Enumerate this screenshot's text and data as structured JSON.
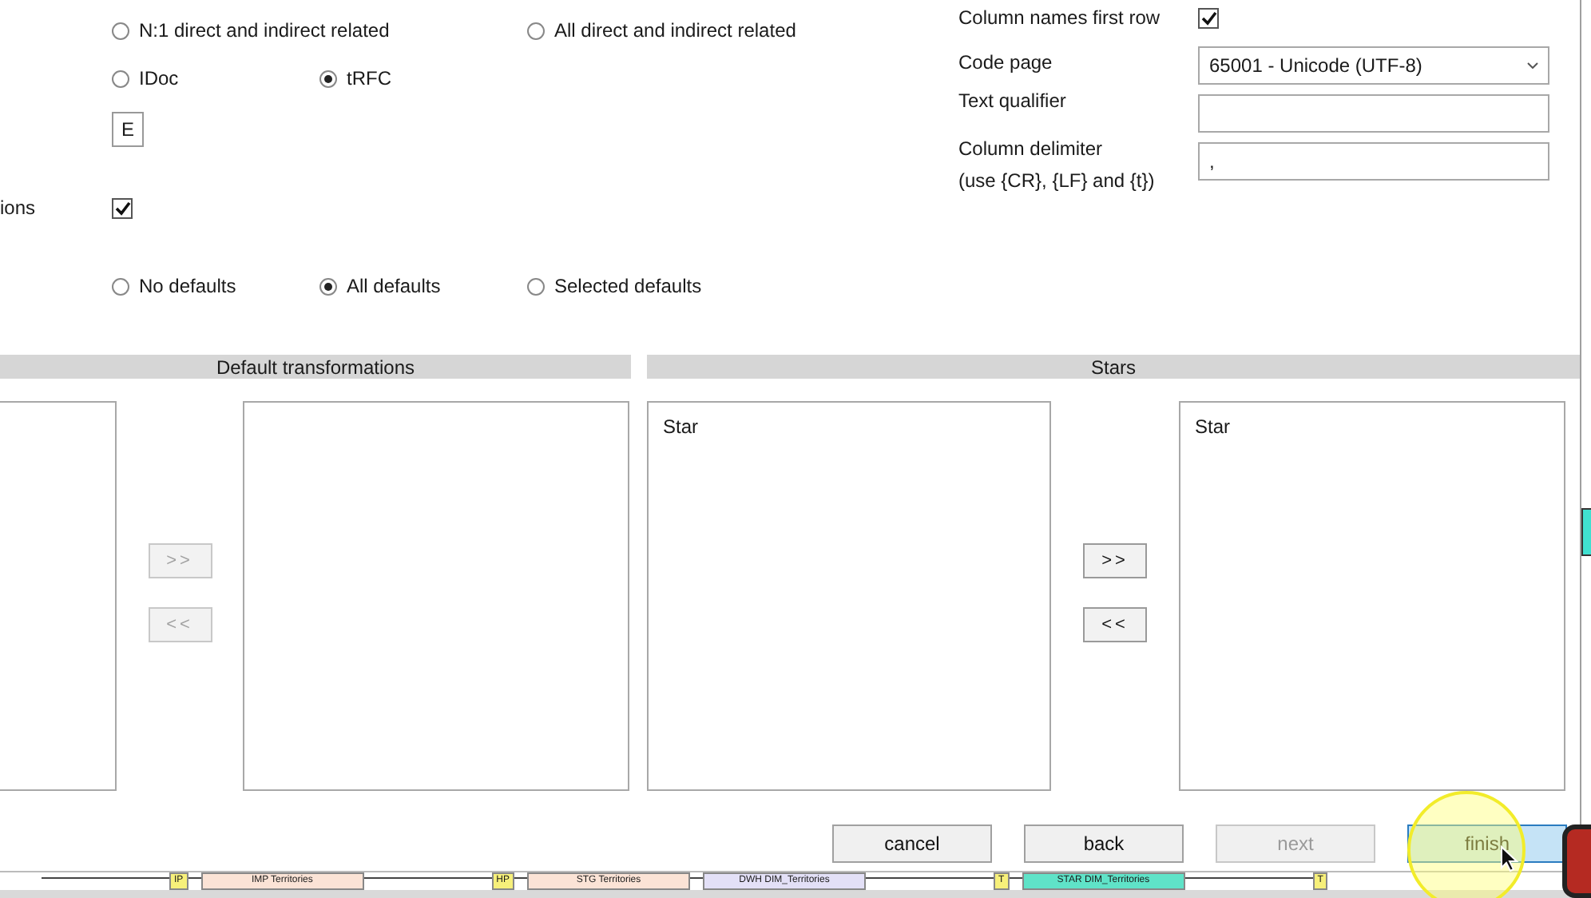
{
  "related_options": [
    {
      "label": "N:1 direct and indirect related",
      "selected": false
    },
    {
      "label": "All direct and indirect related",
      "selected": false
    }
  ],
  "protocol_options": [
    {
      "label": "IDoc",
      "selected": false
    },
    {
      "label": "tRFC",
      "selected": true
    }
  ],
  "code_field": {
    "value": "E"
  },
  "transformations": {
    "label": "ions",
    "checked": true
  },
  "defaults_options": [
    {
      "label": "No defaults",
      "selected": false
    },
    {
      "label": "All defaults",
      "selected": true
    },
    {
      "label": "Selected defaults",
      "selected": false
    }
  ],
  "file_settings": {
    "column_names_first_row": {
      "label": "Column names first row",
      "checked": true
    },
    "code_page": {
      "label": "Code page",
      "value": "65001 - Unicode (UTF-8)"
    },
    "text_qualifier": {
      "label": "Text qualifier"
    },
    "column_delimiter": {
      "label": "Column delimiter",
      "hint": "(use {CR}, {LF} and {t})",
      "value": ","
    }
  },
  "panels": [
    {
      "title": "Default transformations",
      "move_right": ">>",
      "move_left": "<<",
      "disabled": true
    },
    {
      "title": "Stars",
      "left_items": [
        "Star"
      ],
      "right_items": [
        "Star"
      ],
      "move_right": ">>",
      "move_left": "<<",
      "disabled": false
    }
  ],
  "buttons": [
    {
      "label": "cancel",
      "disabled": false,
      "focused": false
    },
    {
      "label": "back",
      "disabled": false,
      "focused": false
    },
    {
      "label": "next",
      "disabled": true,
      "focused": false
    },
    {
      "label": "finish",
      "disabled": false,
      "focused": true
    }
  ],
  "background_diagram": {
    "nodes": [
      {
        "label": "IP",
        "kind": "tag"
      },
      {
        "label": "IMP Territories",
        "kind": "node",
        "color": "#fbe3d6"
      },
      {
        "label": "HP",
        "kind": "tag"
      },
      {
        "label": "STG Territories",
        "kind": "node",
        "color": "#fbe3d6"
      },
      {
        "label": "DWH DIM_Territories",
        "kind": "node",
        "color": "#e3e0f7"
      },
      {
        "label": "T",
        "kind": "tag"
      },
      {
        "label": "STAR DIM_Territories",
        "kind": "node",
        "color": "#5fe3c8"
      },
      {
        "label": "T",
        "kind": "tag"
      }
    ]
  }
}
